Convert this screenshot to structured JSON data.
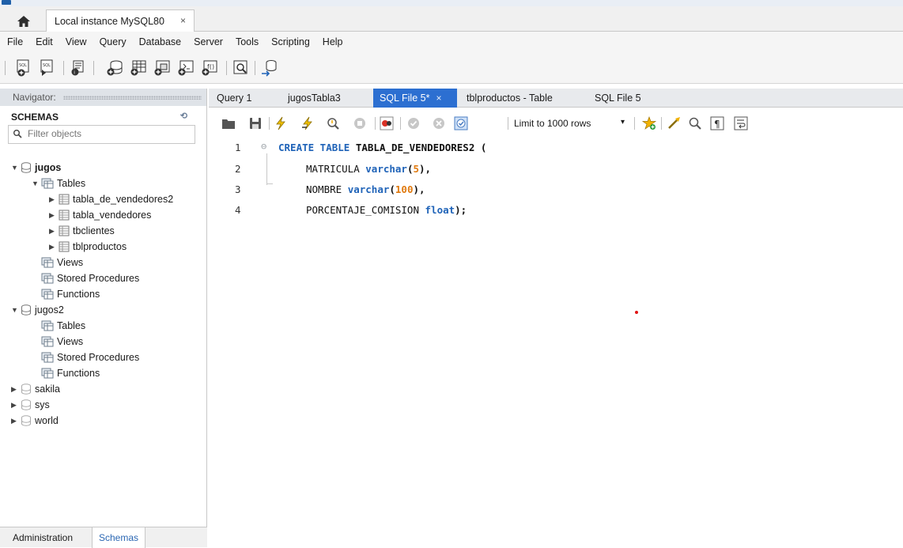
{
  "connection_tab": {
    "label": "Local instance MySQL80",
    "close": "×"
  },
  "menu": [
    "File",
    "Edit",
    "View",
    "Query",
    "Database",
    "Server",
    "Tools",
    "Scripting",
    "Help"
  ],
  "navigator": {
    "title": "Navigator:",
    "schemas_label": "SCHEMAS",
    "filter_placeholder": "Filter objects",
    "tree": {
      "jugos": "jugos",
      "tables": "Tables",
      "t1": "tabla_de_vendedores2",
      "t2": "tabla_vendedores",
      "t3": "tbclientes",
      "t4": "tblproductos",
      "views": "Views",
      "sp": "Stored Procedures",
      "fn": "Functions",
      "jugos2": "jugos2",
      "tables2": "Tables",
      "views2": "Views",
      "sp2": "Stored Procedures",
      "fn2": "Functions",
      "sakila": "sakila",
      "sys": "sys",
      "world": "world"
    },
    "footer_tabs": {
      "admin": "Administration",
      "schemas": "Schemas"
    }
  },
  "query_tabs": {
    "t1": "Query 1",
    "t2": "jugosTabla3",
    "t3": "SQL File 5*",
    "t3_close": "×",
    "t4": "tblproductos - Table",
    "t5": "SQL File 5"
  },
  "editor_toolbar": {
    "limit_label": "Limit to 1000 rows",
    "limit_dropdown": "▾"
  },
  "code": {
    "line_numbers": [
      "1",
      "2",
      "3",
      "4"
    ],
    "l1_kw": "CREATE TABLE",
    "l1_rest": " TABLA_DE_VENDEDORES2 (",
    "l2_name": "MATRICULA ",
    "l2_type": "varchar",
    "l2_open": "(",
    "l2_num": "5",
    "l2_close": "),",
    "l3_name": "NOMBRE ",
    "l3_type": "varchar",
    "l3_open": "(",
    "l3_num": "100",
    "l3_close": "),",
    "l4_name": "PORCENTAJE_COMISION ",
    "l4_type": "float",
    "l4_close": ");"
  },
  "colors": {
    "accent": "#2c6fd1",
    "keyword": "#1f63b8",
    "number": "#e07a10"
  }
}
